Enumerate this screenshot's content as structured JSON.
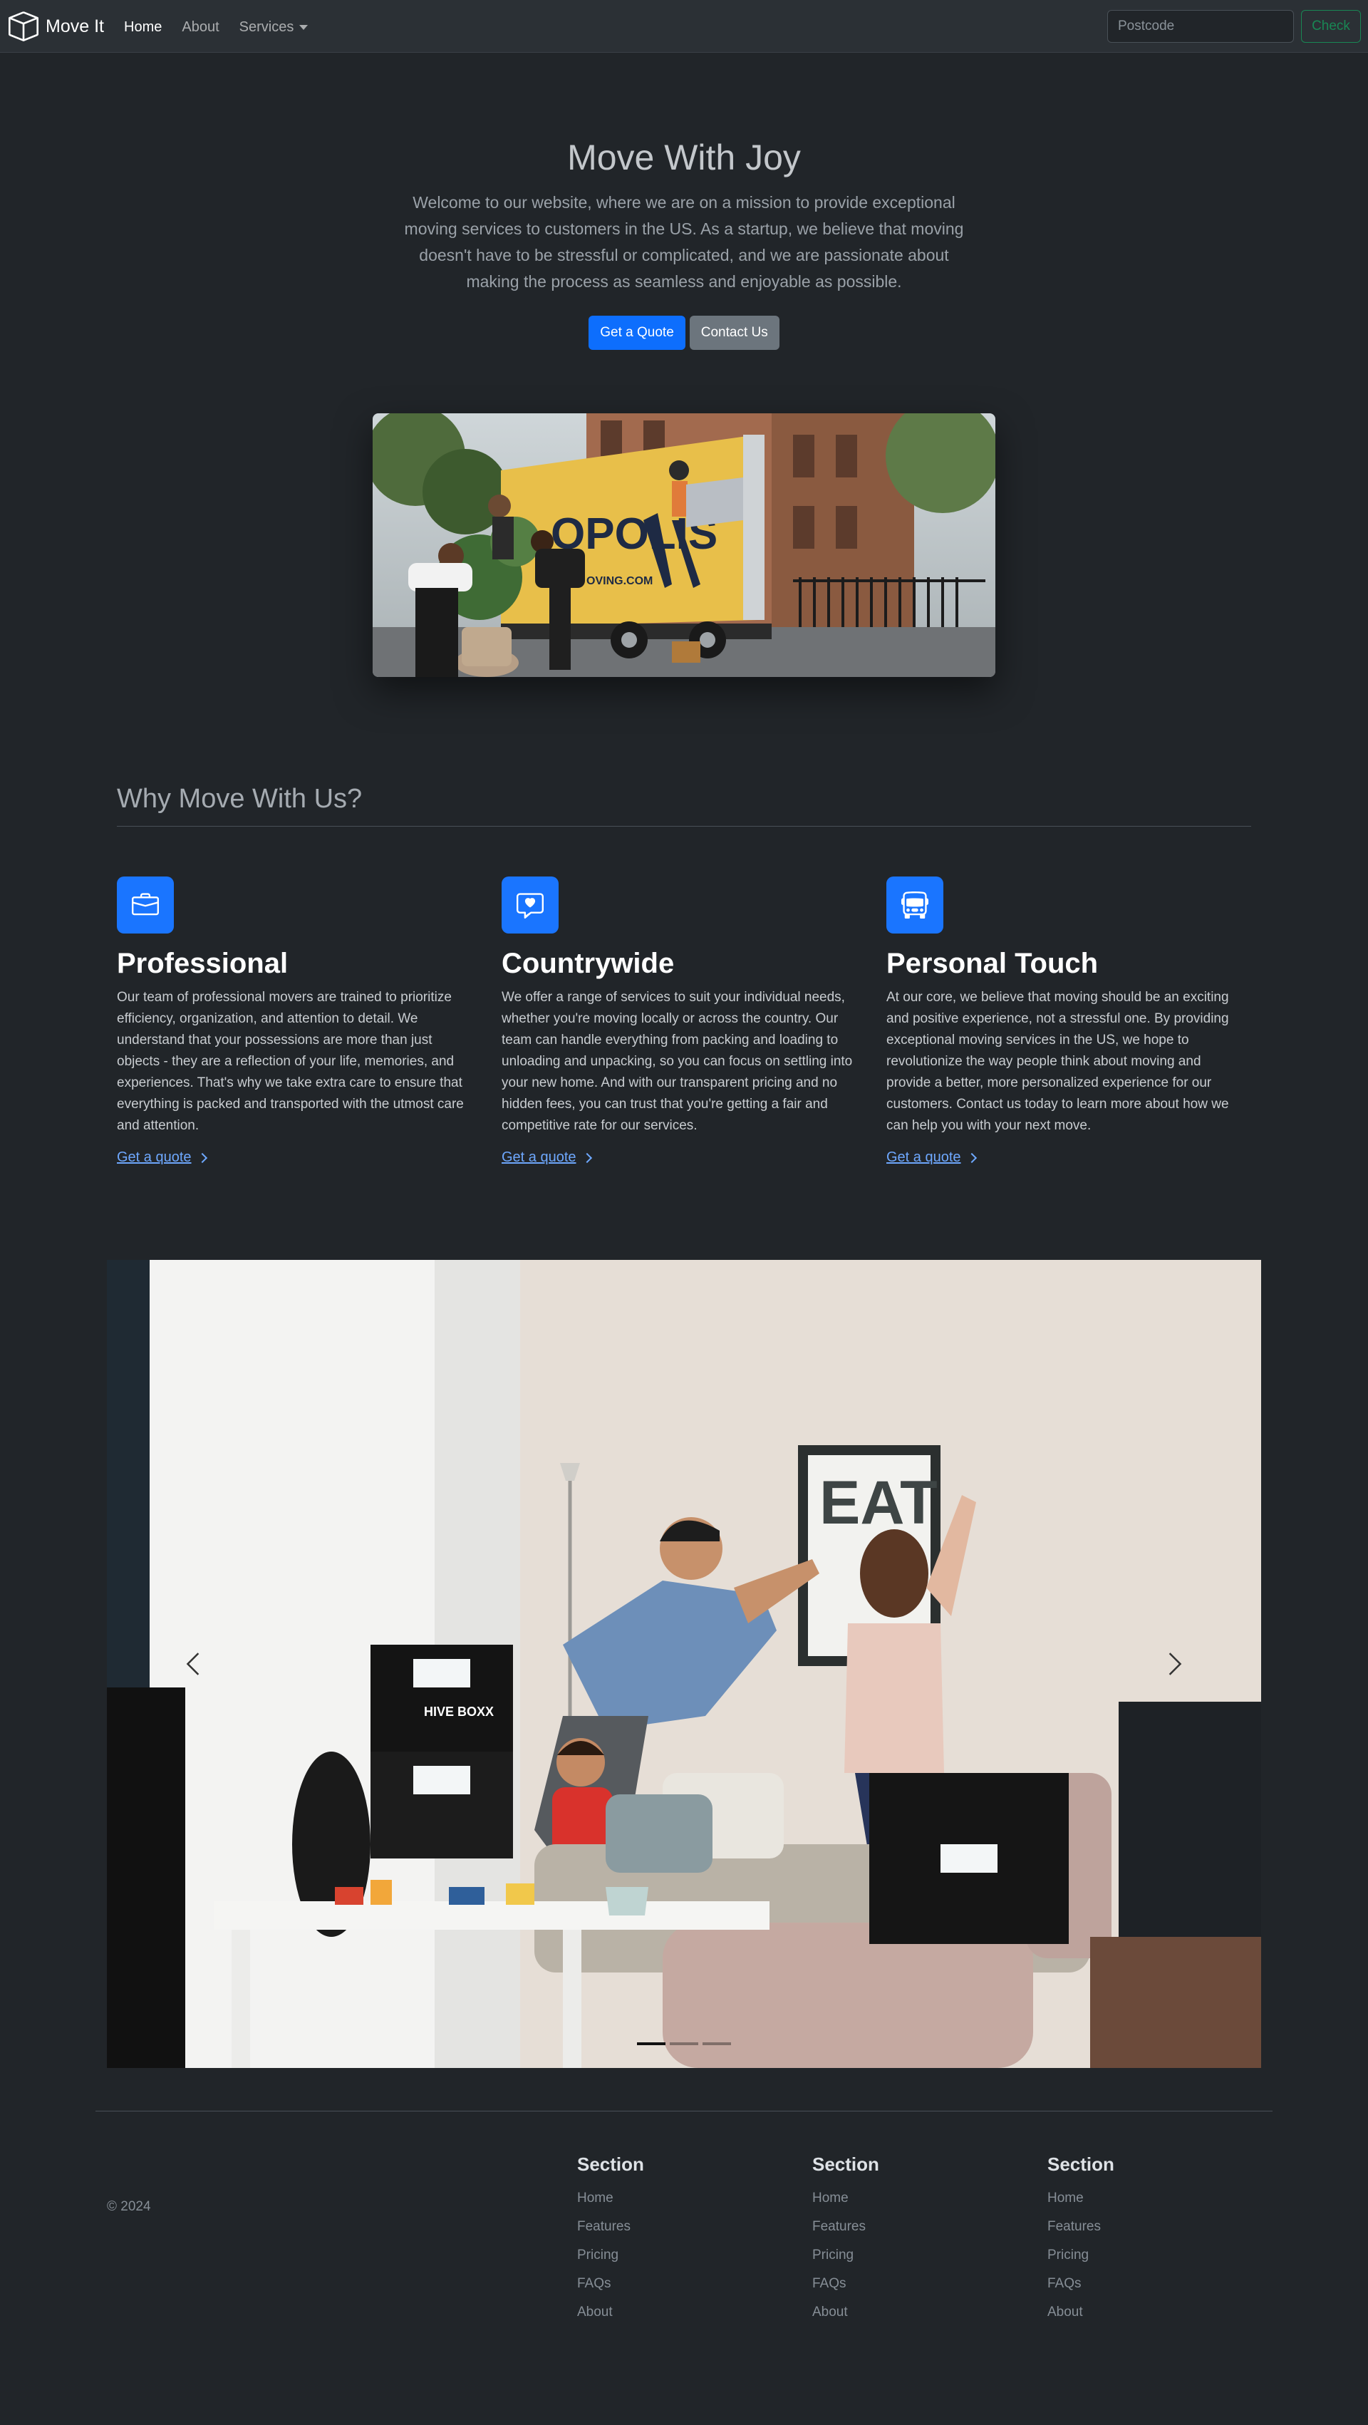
{
  "navbar": {
    "brand": "Move It",
    "links": [
      {
        "label": "Home",
        "active": true
      },
      {
        "label": "About",
        "active": false
      },
      {
        "label": "Services",
        "active": false
      }
    ],
    "search_placeholder": "Postcode",
    "check_label": "Check"
  },
  "hero": {
    "title": "Move With Joy",
    "lead": "Welcome to our website, where we are on a mission to provide exceptional moving services to customers in the US. As a startup, we believe that moving doesn't have to be stressful or complicated, and we are passionate about making the process as seamless and enjoyable as possible.",
    "primary_button": "Get a Quote",
    "secondary_button": "Contact Us",
    "truck_text": "OPOLIS",
    "truck_subtext": "OVING.COM"
  },
  "features": {
    "title": "Why Move With Us?",
    "items": [
      {
        "icon": "briefcase-icon",
        "title": "Professional",
        "text": "Our team of professional movers are trained to prioritize efficiency, organization, and attention to detail. We understand that your possessions are more than just objects - they are a reflection of your life, memories, and experiences. That's why we take extra care to ensure that everything is packed and transported with the utmost care and attention.",
        "link": "Get a quote"
      },
      {
        "icon": "chat-heart-icon",
        "title": "Countrywide",
        "text": "We offer a range of services to suit your individual needs, whether you're moving locally or across the country. Our team can handle everything from packing and loading to unloading and unpacking, so you can focus on settling into your new home. And with our transparent pricing and no hidden fees, you can trust that you're getting a fair and competitive rate for our services.",
        "link": "Get a quote"
      },
      {
        "icon": "bus-icon",
        "title": "Personal Touch",
        "text": "At our core, we believe that moving should be an exciting and positive experience, not a stressful one. By providing exceptional moving services in the US, we hope to revolutionize the way people think about moving and provide a better, more personalized experience for our customers. Contact us today to learn more about how we can help you with your next move.",
        "link": "Get a quote"
      }
    ]
  },
  "carousel": {
    "slide_count": 3,
    "active_index": 0,
    "poster_text": "EAT",
    "box_text": "HIVE BOXX"
  },
  "footer": {
    "copyright": "© 2024",
    "columns": [
      {
        "title": "Section",
        "links": [
          "Home",
          "Features",
          "Pricing",
          "FAQs",
          "About"
        ]
      },
      {
        "title": "Section",
        "links": [
          "Home",
          "Features",
          "Pricing",
          "FAQs",
          "About"
        ]
      },
      {
        "title": "Section",
        "links": [
          "Home",
          "Features",
          "Pricing",
          "FAQs",
          "About"
        ]
      }
    ]
  },
  "colors": {
    "background": "#212529",
    "navbar": "#2b3035",
    "primary": "#0d6efd",
    "secondary": "#6c757d",
    "success": "#198754",
    "link": "#6ea8fe"
  }
}
